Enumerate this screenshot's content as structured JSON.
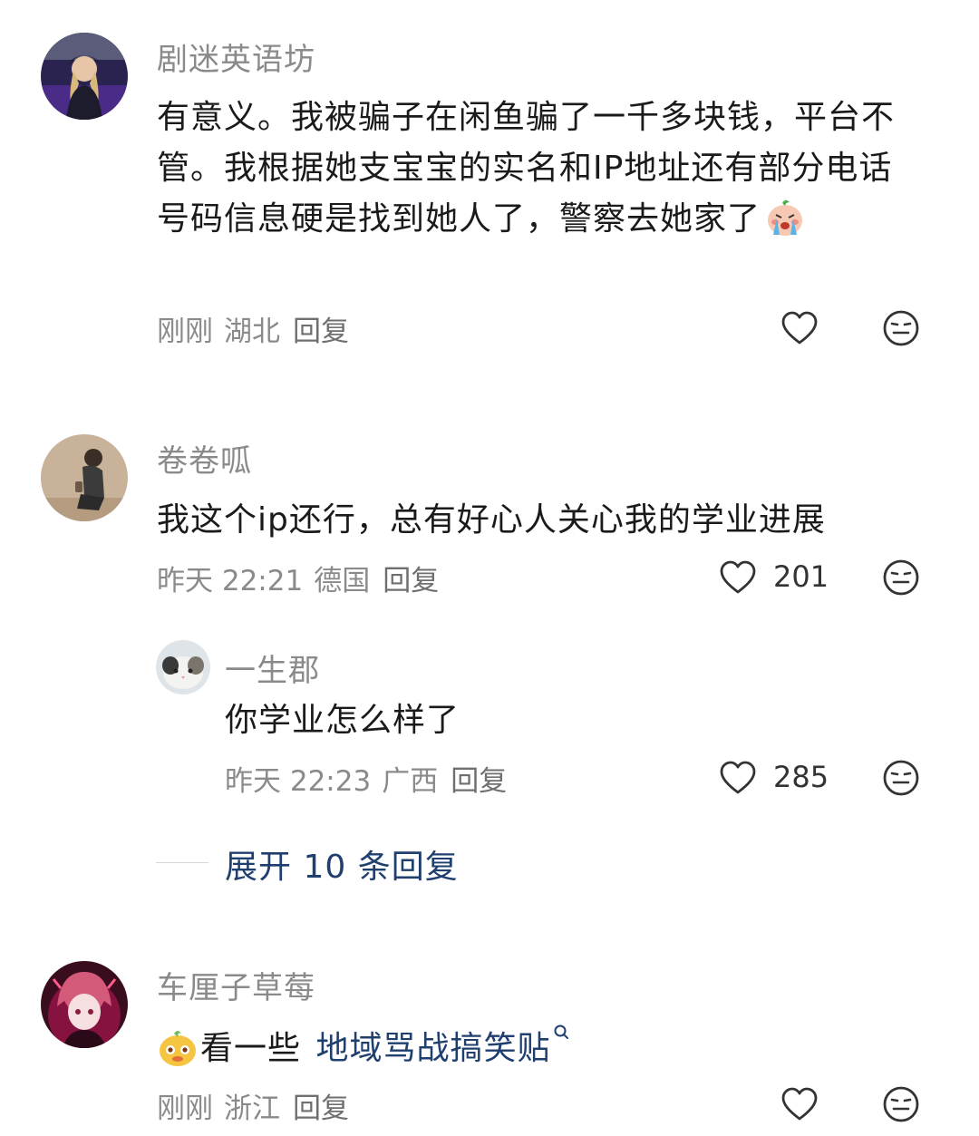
{
  "comments": [
    {
      "username": "剧迷英语坊",
      "text": "有意义。我被骗子在闲鱼骗了一千多块钱，平台不管。我根据她支宝宝的实名和IP地址还有部分电话号码信息硬是找到她人了，警察去她家了",
      "emoji": "crying-face-sticker",
      "time": "刚刚",
      "location": "湖北",
      "reply_label": "回复",
      "likes": ""
    },
    {
      "username": "卷卷呱",
      "text": "我这个ip还行，总有好心人关心我的学业进展",
      "time": "昨天 22:21",
      "location": "德国",
      "reply_label": "回复",
      "likes": "201",
      "replies": [
        {
          "username": "一生郡",
          "text": "你学业怎么样了",
          "time": "昨天 22:23",
          "location": "广西",
          "reply_label": "回复",
          "likes": "285"
        }
      ],
      "expand_label": "展开 10 条回复"
    },
    {
      "username": "车厘子草莓",
      "text_prefix": "看一些",
      "search_link": "地域骂战搞笑贴",
      "emoji": "yellow-bun-sticker",
      "time": "刚刚",
      "location": "浙江",
      "reply_label": "回复",
      "likes": ""
    }
  ],
  "icons": {
    "like": "heart-outline-icon",
    "dislike": "meh-face-icon",
    "search": "search-icon"
  },
  "colors": {
    "username": "#8a8a8a",
    "text": "#1a1a1a",
    "meta": "#8a8a8a",
    "link": "#1f3f6e"
  }
}
